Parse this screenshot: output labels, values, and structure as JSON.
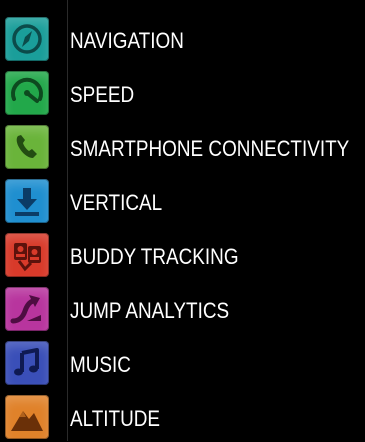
{
  "menu": {
    "items": [
      {
        "label": "NAVIGATION",
        "icon": "compass-icon",
        "color": "#1a9e9a"
      },
      {
        "label": "SPEED",
        "icon": "speedometer-icon",
        "color": "#22a84a"
      },
      {
        "label": "SMARTPHONE CONNECTIVITY",
        "icon": "phone-icon",
        "color": "#6ab43a"
      },
      {
        "label": "VERTICAL",
        "icon": "download-arrow-icon",
        "color": "#1f8fd0"
      },
      {
        "label": "BUDDY TRACKING",
        "icon": "buddy-map-icon",
        "color": "#d83a2a"
      },
      {
        "label": "JUMP ANALYTICS",
        "icon": "jump-arrow-icon",
        "color": "#b8359e"
      },
      {
        "label": "MUSIC",
        "icon": "music-note-icon",
        "color": "#3a4fb8"
      },
      {
        "label": "ALTITUDE",
        "icon": "mountain-icon",
        "color": "#e0822a"
      }
    ]
  }
}
